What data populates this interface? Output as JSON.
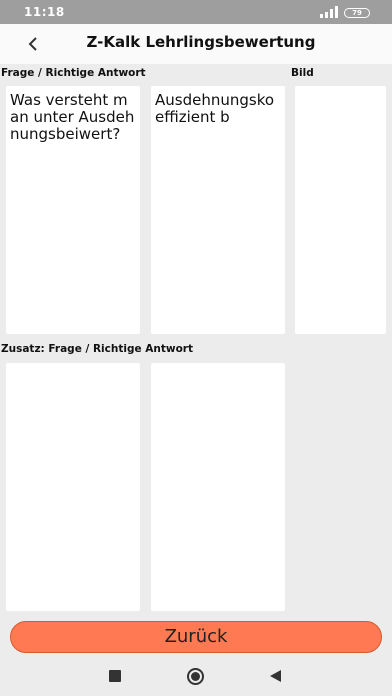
{
  "status": {
    "time": "11:18",
    "battery": "79"
  },
  "header": {
    "title": "Z-Kalk Lehrlingsbewertung"
  },
  "sections": {
    "main_label": "Frage / Richtige Antwort",
    "image_label": "Bild",
    "extra_label": "Zusatz: Frage / Richtige Antwort"
  },
  "cards": {
    "question": "Was versteht man unter Ausdehnungsbeiwert?",
    "answer": "Ausdehnungskoeffizient b",
    "extra_question": "",
    "extra_answer": ""
  },
  "actions": {
    "back_label": "Zurück"
  },
  "colors": {
    "accent": "#ff7a52"
  }
}
